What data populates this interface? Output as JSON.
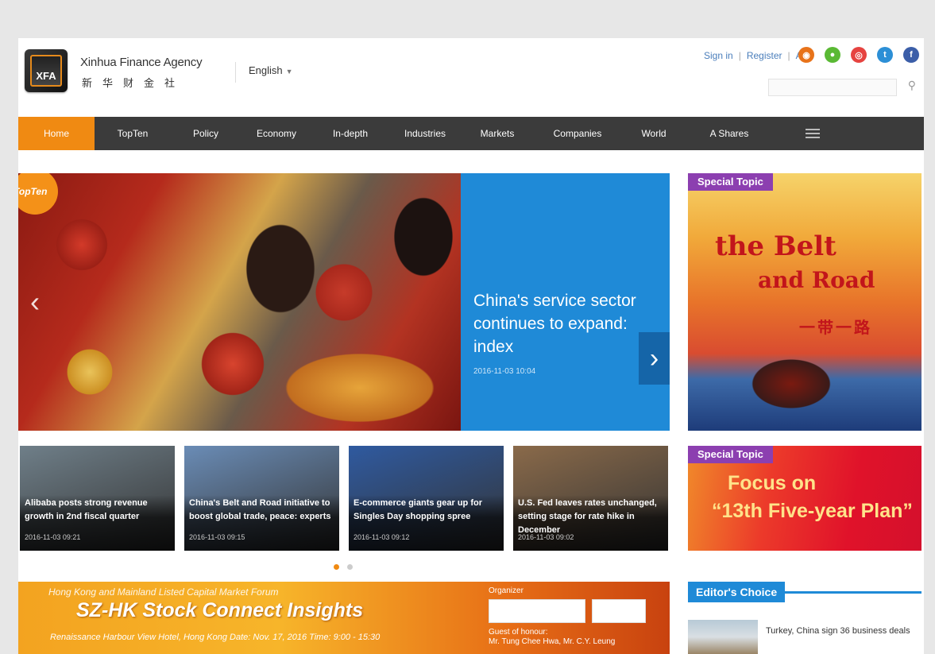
{
  "header": {
    "logo_text": "XFA",
    "brand_en": "Xinhua Finance Agency",
    "brand_cn": "新华财金社",
    "language": "English",
    "links": [
      "Sign in",
      "Register",
      "App"
    ]
  },
  "social": [
    {
      "name": "rss-icon",
      "glyph": "◉",
      "color": "#e8731a"
    },
    {
      "name": "wechat-icon",
      "glyph": "●",
      "color": "#5ab934"
    },
    {
      "name": "weibo-icon",
      "glyph": "◎",
      "color": "#e64340"
    },
    {
      "name": "twitter-icon",
      "glyph": "t",
      "color": "#2c8fd6"
    },
    {
      "name": "facebook-icon",
      "glyph": "f",
      "color": "#3b5ea8"
    }
  ],
  "nav": {
    "items": [
      "Home",
      "TopTen",
      "Policy",
      "Economy",
      "In-depth",
      "Industries",
      "Markets",
      "Companies",
      "World",
      "A Shares"
    ],
    "active": "Home"
  },
  "hero": {
    "tag": "TopTen",
    "title": "China's service sector continues to expand: index",
    "date": "2016-11-03 10:04"
  },
  "thumbs": [
    {
      "title": "Alibaba posts strong revenue growth in 2nd fiscal quarter",
      "date": "2016-11-03 09:21",
      "bg": "#6f7f89"
    },
    {
      "title": "China's Belt and Road initiative to boost global trade, peace: experts",
      "date": "2016-11-03 09:15",
      "bg": "#6a8cb6"
    },
    {
      "title": "E-commerce giants gear up for Singles Day shopping spree",
      "date": "2016-11-03 09:12",
      "bg": "#2f5aa0"
    },
    {
      "title": "U.S. Fed leaves rates unchanged, setting stage for rate hike in December",
      "date": "2016-11-03 09:02",
      "bg": "#8a6a4a"
    }
  ],
  "banner": {
    "top": "Hong Kong and Mainland Listed Capital Market Forum",
    "title": "SZ-HK Stock Connect Insights",
    "sub": "Renaissance Harbour View Hotel, Hong Kong   Date: Nov. 17, 2016   Time: 9:00 - 15:30",
    "org_label": "Organizer",
    "guest_label": "Guest of honour:",
    "guest_names": "Mr. Tung Chee Hwa, Mr. C.Y. Leung"
  },
  "side": {
    "tag1": "Special Topic",
    "topic1_line1": "the Belt",
    "topic1_line2": "and Road",
    "topic1_cn": "一带一路",
    "tag2": "Special Topic",
    "topic2_line1": "Focus on",
    "topic2_line2": "“13th Five-year Plan”"
  },
  "editor": {
    "heading": "Editor's Choice",
    "item_title": "Turkey, China sign 36 business deals"
  }
}
